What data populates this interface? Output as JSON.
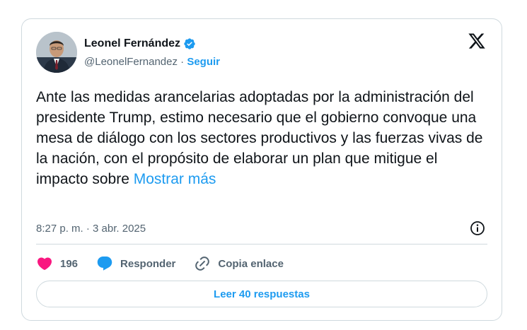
{
  "author": {
    "name": "Leonel Fernández",
    "handle": "@LeonelFernandez",
    "separator": " · ",
    "follow_label": "Seguir",
    "verified_color": "#1d9bf0"
  },
  "tweet": {
    "text": "Ante las medidas arancelarias adoptadas por la administración del presidente Trump, estimo necesario que el gobierno convoque una mesa de diálogo con los sectores productivos y las fuerzas vivas de la nación, con el propósito de elaborar un plan que mitigue el impacto sobre ",
    "show_more_label": "Mostrar más",
    "timestamp": "8:27 p. m. · 3 abr. 2025"
  },
  "actions": {
    "like_count": "196",
    "reply_label": "Responder",
    "copy_link_label": "Copia enlace"
  },
  "replies_button_label": "Leer 40 respuestas",
  "icons": {
    "like": "heart-icon",
    "reply": "speech-bubble-icon",
    "copy_link": "link-icon",
    "info": "info-icon",
    "brand": "x-logo-icon"
  },
  "colors": {
    "accent": "#1d9bf0",
    "like": "#f91880",
    "text": "#0f1419",
    "muted": "#536471",
    "border": "#cfd9de"
  }
}
